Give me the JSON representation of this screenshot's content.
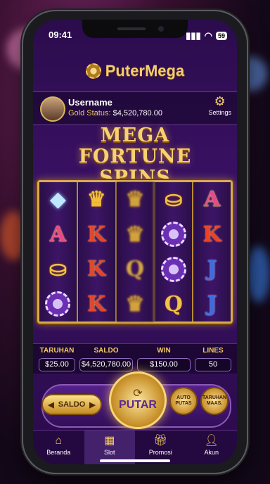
{
  "status": {
    "time": "09:41",
    "battery": "59"
  },
  "brand": {
    "name": "PuterMega"
  },
  "user": {
    "name": "Username",
    "gold_label": "Gold Status:",
    "gold_value": "$4,520,780.00",
    "settings_label": "Settings"
  },
  "game": {
    "title_line1": "MEGA",
    "title_line2": "FORTUNE",
    "title_line3": "SPINS"
  },
  "reels": [
    [
      "gem",
      "A",
      "coins",
      "chip"
    ],
    [
      "crown",
      "K",
      "K",
      "K"
    ],
    [
      "blur",
      "crown",
      "Q",
      "blur"
    ],
    [
      "coins",
      "chip",
      "chip",
      "Q"
    ],
    [
      "A",
      "K",
      "J",
      "J"
    ]
  ],
  "stats": {
    "bet": {
      "label": "TARUHAN",
      "value": "$25.00"
    },
    "balance": {
      "label": "SALDO",
      "value": "$4,520,780.00"
    },
    "win": {
      "label": "WIN",
      "value": "$150.00"
    },
    "lines": {
      "label": "LINES",
      "value": "50"
    }
  },
  "controls": {
    "saldo_label": "SALDO",
    "spin_label": "PUTAR",
    "auto_label_1": "AUTO",
    "auto_label_2": "PUTAS",
    "maxbet_label_1": "TARUHAN",
    "maxbet_label_2": "MAAS."
  },
  "tabs": [
    {
      "label": "Beranda",
      "icon": "home-icon"
    },
    {
      "label": "Slot",
      "icon": "slot-icon"
    },
    {
      "label": "Promosi",
      "icon": "gift-icon"
    },
    {
      "label": "Akun",
      "icon": "user-icon"
    }
  ],
  "colors": {
    "gold": "#f2c862",
    "purple": "#3b1166"
  }
}
